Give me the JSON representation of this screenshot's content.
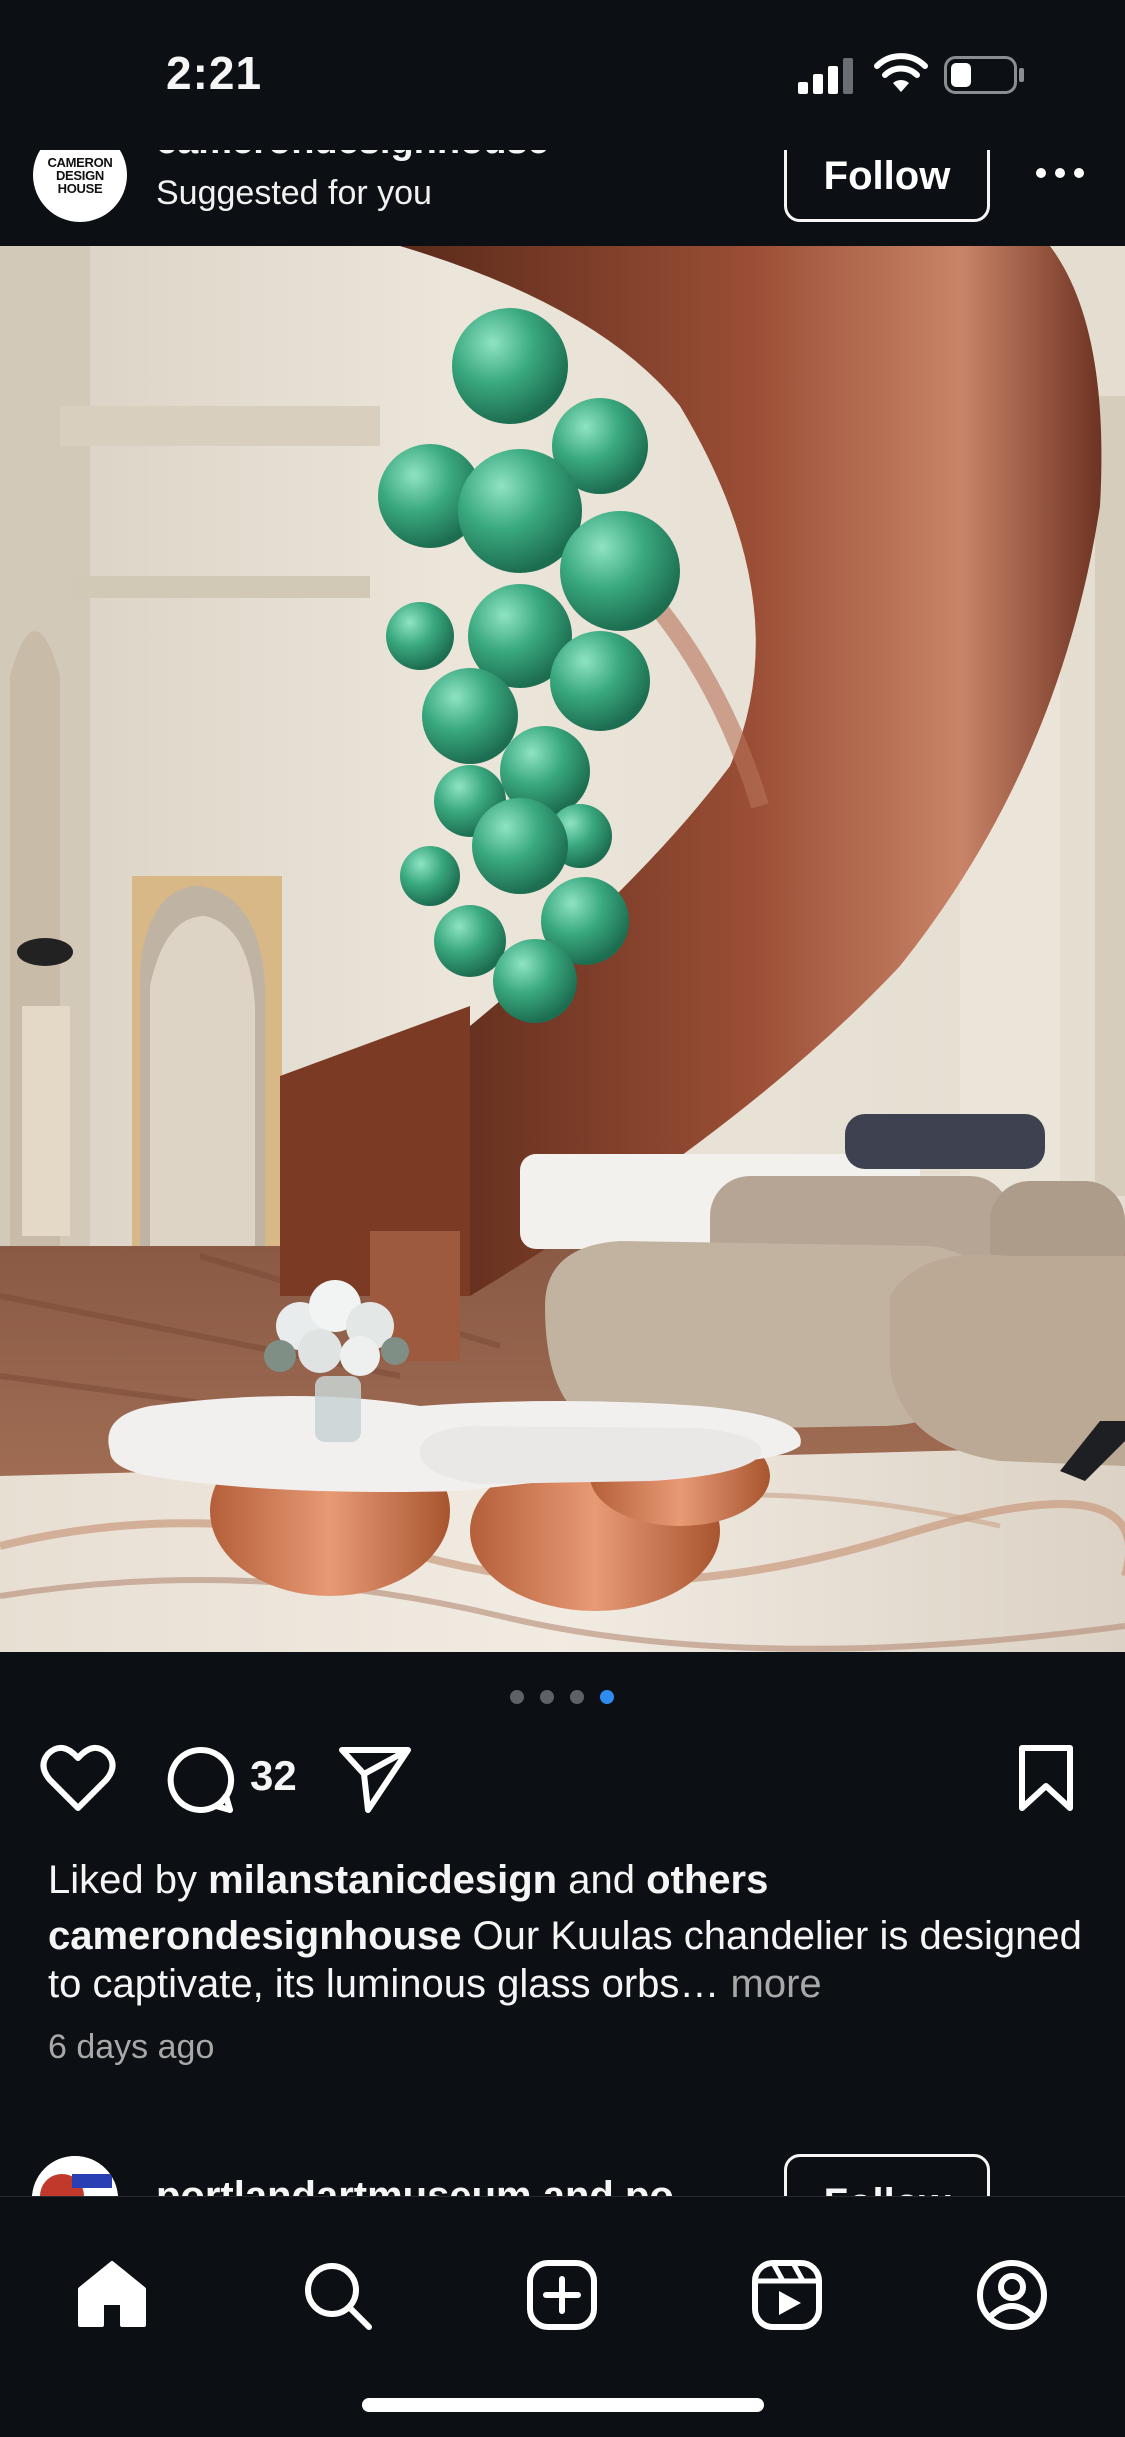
{
  "status_bar": {
    "time": "2:21"
  },
  "post": {
    "avatar_text": [
      "CAMERON",
      "DESIGN",
      "HOUSE"
    ],
    "username": "camerondesignhouse",
    "subtitle": "Suggested for you",
    "follow_label": "Follow",
    "comment_count": "32",
    "carousel": {
      "count": 4,
      "active_index": 3
    },
    "liked_prefix": "Liked by ",
    "liked_user": "milanstanicdesign",
    "liked_and": " and ",
    "liked_others": "others",
    "caption_user": "camerondesignhouse",
    "caption_text": " Our Kuulas chandelier is designed to captivate, its luminous glass orbs…",
    "caption_more": " more",
    "time_ago": "6 days ago"
  },
  "next_post": {
    "username": "portlandartmuseum and po",
    "follow_label": "Follow"
  },
  "icons": {
    "like": "heart-icon",
    "comment": "comment-icon",
    "share": "send-icon",
    "save": "bookmark-icon",
    "nav": [
      "home-icon",
      "search-icon",
      "add-icon",
      "reels-icon",
      "profile-icon"
    ]
  },
  "colors": {
    "background": "#0c1014",
    "accent_dot": "#2e8cf0",
    "muted_text": "#a8a8a8"
  }
}
